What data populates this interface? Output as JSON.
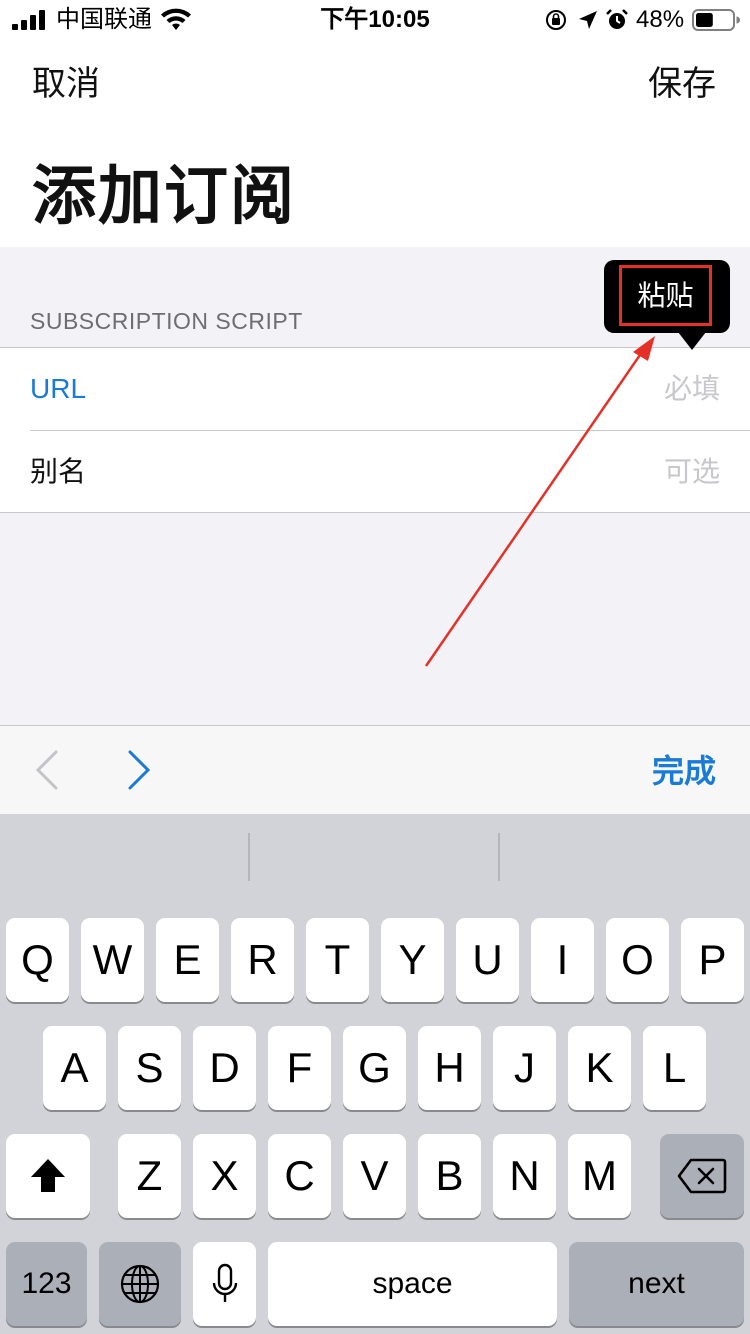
{
  "status_bar": {
    "carrier": "中国联通",
    "time": "下午10:05",
    "battery_percent": "48%",
    "battery_level": 0.48
  },
  "nav": {
    "cancel_label": "取消",
    "save_label": "保存",
    "title": "添加订阅"
  },
  "form": {
    "section_header": "SUBSCRIPTION SCRIPT",
    "url": {
      "label": "URL",
      "placeholder": "必填",
      "value": ""
    },
    "alias": {
      "label": "别名",
      "placeholder": "可选",
      "value": ""
    }
  },
  "callout": {
    "paste_label": "粘贴"
  },
  "annotation": {
    "color": "#e53028"
  },
  "accessory_bar": {
    "done_label": "完成"
  },
  "keyboard": {
    "row1": [
      "Q",
      "W",
      "E",
      "R",
      "T",
      "Y",
      "U",
      "I",
      "O",
      "P"
    ],
    "row2": [
      "A",
      "S",
      "D",
      "F",
      "G",
      "H",
      "J",
      "K",
      "L"
    ],
    "row3": [
      "Z",
      "X",
      "C",
      "V",
      "B",
      "N",
      "M"
    ],
    "numbers_label": "123",
    "space_label": "space",
    "next_label": "next"
  },
  "colors": {
    "accent": "#1a7ad8",
    "grouped_background": "#f2f2f7",
    "keyboard_background": "#d1d3d9"
  }
}
